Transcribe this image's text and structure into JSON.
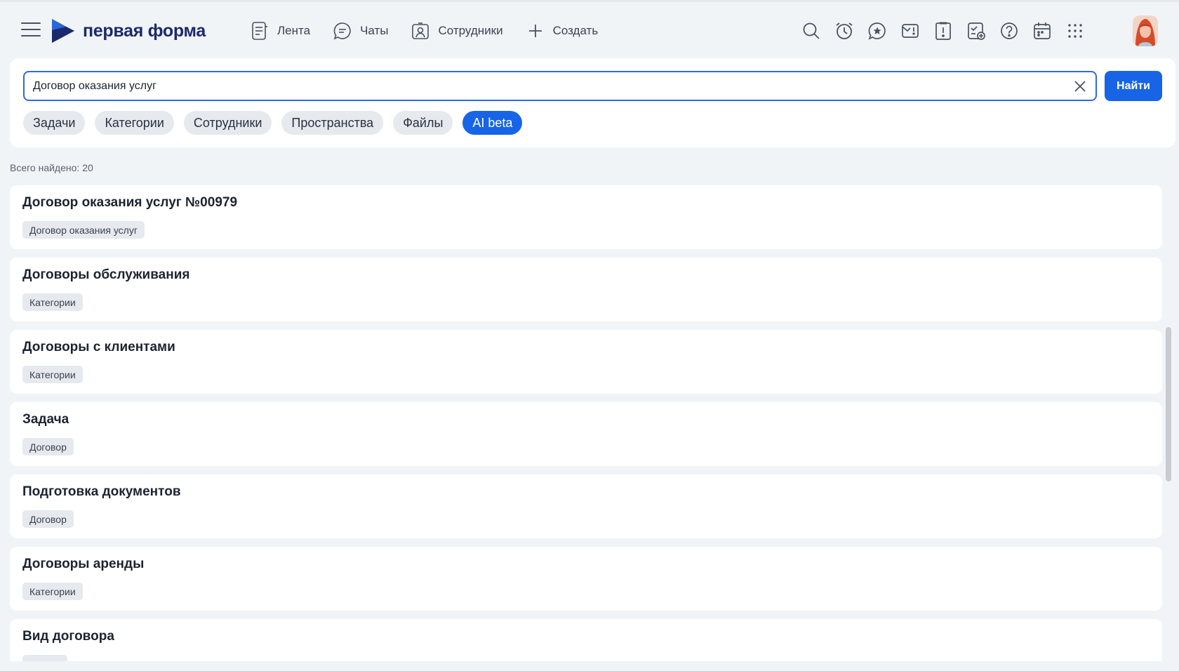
{
  "header": {
    "brand": "первая форма",
    "nav": [
      {
        "label": "Лента",
        "icon": "feed-icon"
      },
      {
        "label": "Чаты",
        "icon": "chat-icon"
      },
      {
        "label": "Сотрудники",
        "icon": "employees-icon"
      },
      {
        "label": "Создать",
        "icon": "plus-icon"
      }
    ],
    "right_icons": [
      "search-icon",
      "alarm-clock-icon",
      "favorites-star-icon",
      "mail-icon",
      "important-icon",
      "approval-icon",
      "help-icon",
      "calendar-icon",
      "apps-grid-icon"
    ]
  },
  "search": {
    "value": "Договор оказания услуг",
    "button_label": "Найти",
    "filters": [
      "Задачи",
      "Категории",
      "Сотрудники",
      "Пространства",
      "Файлы",
      "AI beta"
    ],
    "active_filter": "AI beta"
  },
  "results_count": "Всего найдено: 20",
  "results": [
    {
      "title": "Договор оказания услуг №00979",
      "tag": "Договор оказания услуг"
    },
    {
      "title": "Договоры обслуживания",
      "tag": "Категории"
    },
    {
      "title": "Договоры с клиентами",
      "tag": "Категории"
    },
    {
      "title": "Задача",
      "tag": "Договор"
    },
    {
      "title": "Подготовка документов",
      "tag": "Договор"
    },
    {
      "title": "Договоры аренды",
      "tag": "Категории"
    },
    {
      "title": "Вид договора",
      "tag": ""
    }
  ],
  "colors": {
    "accent": "#1765e6",
    "brand": "#1b2a6b",
    "background": "#f1f4f7"
  }
}
